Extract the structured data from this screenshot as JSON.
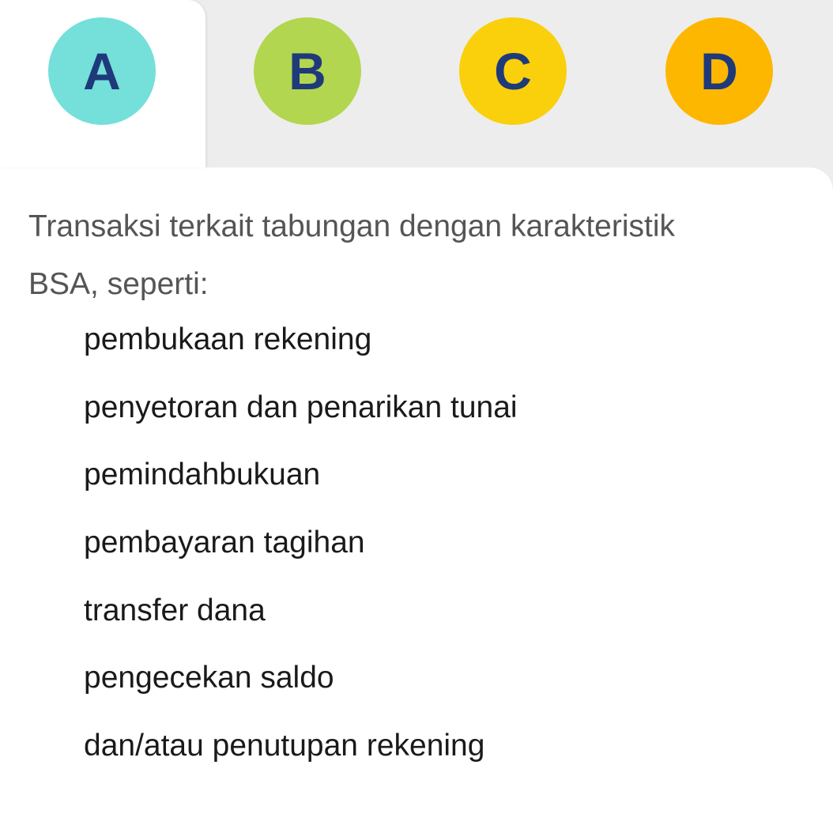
{
  "tabs": [
    {
      "letter": "A",
      "color": "#74e0d9",
      "active": true
    },
    {
      "letter": "B",
      "color": "#b2d64f",
      "active": false
    },
    {
      "letter": "C",
      "color": "#f9d00b",
      "active": false
    },
    {
      "letter": "D",
      "color": "#fdb700",
      "active": false
    }
  ],
  "content": {
    "intro": "Transaksi terkait tabungan dengan karakteristik BSA, seperti:",
    "items": [
      "pembukaan rekening",
      "penyetoran dan penarikan tunai",
      "pemindahbukuan",
      "pembayaran tagihan",
      "transfer dana",
      "pengecekan saldo",
      "dan/atau penutupan rekening"
    ]
  },
  "colors": {
    "letter": "#1f3a7a",
    "tab_bar_bg": "#ededed",
    "panel_bg": "#ffffff",
    "intro_text": "#555555",
    "item_text": "#1a1a1a"
  }
}
